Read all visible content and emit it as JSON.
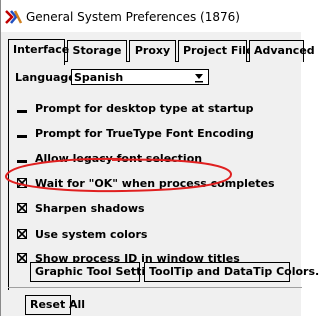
{
  "window": {
    "title": "General System Preferences (1876)"
  },
  "tabs": [
    {
      "label": "Interface",
      "active": true
    },
    {
      "label": "Storage",
      "active": false
    },
    {
      "label": "Proxy",
      "active": false
    },
    {
      "label": "Project File",
      "active": false
    },
    {
      "label": "Advanced",
      "active": false
    }
  ],
  "language": {
    "label": "Language",
    "value": "Spanish"
  },
  "options": [
    {
      "label": "Prompt for desktop type at startup",
      "checked": false
    },
    {
      "label": "Prompt for TrueType Font Encoding",
      "checked": false
    },
    {
      "label": "Allow legacy font selection",
      "checked": false
    },
    {
      "label": "Wait for \"OK\" when process completes",
      "checked": true
    },
    {
      "label": "Sharpen shadows",
      "checked": true
    },
    {
      "label": "Use system colors",
      "checked": true
    },
    {
      "label": "Show process ID in window titles",
      "checked": true
    }
  ],
  "buttons": {
    "graphic_tool": "Graphic Tool Settings...",
    "tooltip": "ToolTip and DataTip Colors...",
    "reset": "Reset All"
  },
  "colors": {
    "highlight_ellipse": "#e02020"
  }
}
